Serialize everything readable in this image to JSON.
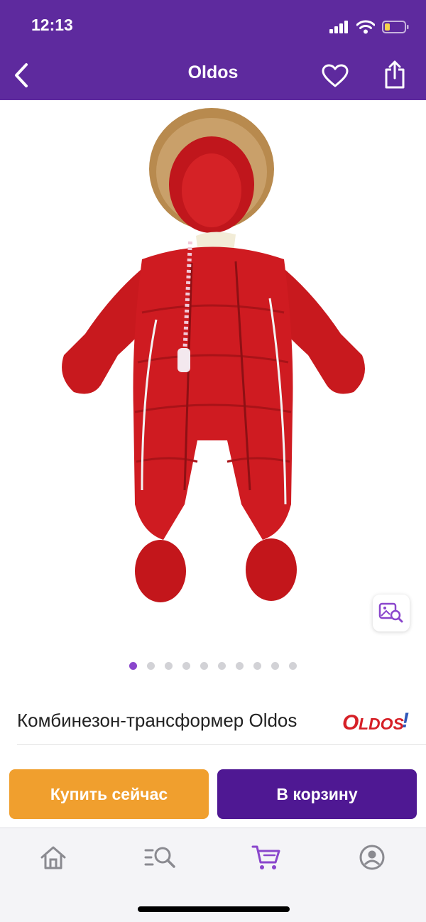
{
  "status_bar": {
    "time": "12:13"
  },
  "header": {
    "title": "Oldos",
    "bg_color": "#5e2a9e"
  },
  "gallery": {
    "image_count": 10,
    "active_index": 0
  },
  "product": {
    "title": "Комбинезон-трансформер Oldos"
  },
  "brand": {
    "logo_text": "OLDOS!"
  },
  "actions": {
    "buy_now_label": "Купить сейчас",
    "add_to_cart_label": "В корзину"
  },
  "colors": {
    "accent": "#5e2a9e",
    "buy_now": "#f09f2e",
    "cart_button": "#4f1893",
    "product": "#c8191e"
  },
  "icons": {
    "status": [
      "cellular-signal-icon",
      "wifi-icon",
      "battery-icon"
    ],
    "header": [
      "back-arrow-icon",
      "heart-icon",
      "share-icon"
    ],
    "tabbar": [
      "home-icon",
      "catalog-search-icon",
      "cart-icon",
      "profile-icon"
    ],
    "image": [
      "visual-search-icon"
    ]
  },
  "tabbar": {
    "active": "cart"
  }
}
